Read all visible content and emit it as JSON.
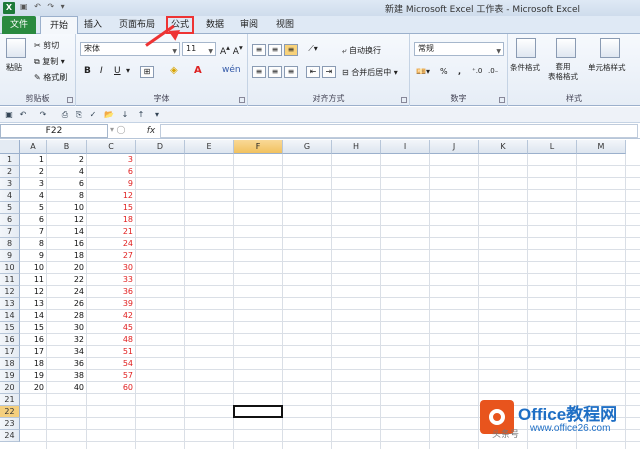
{
  "window": {
    "title": "新建 Microsoft Excel 工作表 - Microsoft Excel",
    "app_icon": "X"
  },
  "tabs": [
    {
      "label": "文件",
      "kind": "file"
    },
    {
      "label": "开始",
      "kind": "active"
    },
    {
      "label": "插入",
      "kind": "normal"
    },
    {
      "label": "页面布局",
      "kind": "normal"
    },
    {
      "label": "公式",
      "kind": "highlight"
    },
    {
      "label": "数据",
      "kind": "normal"
    },
    {
      "label": "审阅",
      "kind": "normal"
    },
    {
      "label": "视图",
      "kind": "normal"
    }
  ],
  "ribbon": {
    "clipboard": {
      "label": "剪贴板",
      "paste": "粘贴",
      "cut": "剪切",
      "copy": "复制",
      "format_painter": "格式刷"
    },
    "font": {
      "label": "字体",
      "font_name": "宋体",
      "font_size": "11",
      "bold": "B",
      "italic": "I",
      "underline": "U"
    },
    "alignment": {
      "label": "对齐方式",
      "wrap": "自动换行",
      "merge": "合并后居中"
    },
    "number": {
      "label": "数字",
      "format": "常规",
      "percent": "%",
      "comma": ","
    },
    "styles": {
      "label": "样式",
      "conditional": "条件格式",
      "table": "套用\n表格格式",
      "cell_styles": "单元格样式"
    }
  },
  "formula_bar": {
    "name_box": "F22",
    "fx": "fx",
    "value": ""
  },
  "columns": [
    "A",
    "B",
    "C",
    "D",
    "E",
    "F",
    "G",
    "H",
    "I",
    "J",
    "K",
    "L",
    "M"
  ],
  "selected_column": "F",
  "rows": [
    "1",
    "2",
    "3",
    "4",
    "5",
    "6",
    "7",
    "8",
    "9",
    "10",
    "11",
    "12",
    "13",
    "14",
    "15",
    "16",
    "17",
    "18",
    "19",
    "20",
    "21",
    "22",
    "23",
    "24"
  ],
  "selected_row": "22",
  "data": {
    "A": [
      "1",
      "2",
      "3",
      "4",
      "5",
      "6",
      "7",
      "8",
      "9",
      "10",
      "11",
      "12",
      "13",
      "14",
      "15",
      "16",
      "17",
      "18",
      "19",
      "20"
    ],
    "B": [
      "2",
      "4",
      "6",
      "8",
      "10",
      "12",
      "14",
      "16",
      "18",
      "20",
      "22",
      "24",
      "26",
      "28",
      "30",
      "32",
      "34",
      "36",
      "38",
      "40"
    ],
    "C": [
      "3",
      "6",
      "9",
      "12",
      "15",
      "18",
      "21",
      "24",
      "27",
      "30",
      "33",
      "36",
      "39",
      "42",
      "45",
      "48",
      "51",
      "54",
      "57",
      "60"
    ]
  },
  "colors": {
    "file_tab": "#2a8a3f",
    "formula_values": "#e02020",
    "highlight": "#e33333",
    "watermark": "#1f6fc5"
  },
  "watermark": {
    "title": "Office教程网",
    "url": "www.office26.com",
    "small": "头条号"
  }
}
